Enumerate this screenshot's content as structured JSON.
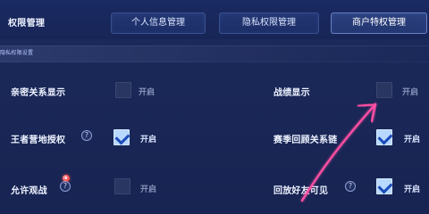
{
  "header": {
    "title": "权限管理",
    "tabs": [
      {
        "label": "个人信息管理"
      },
      {
        "label": "隐私权限管理"
      },
      {
        "label": "商户特权管理"
      }
    ]
  },
  "section": {
    "label": "隐私权限设置"
  },
  "settings": [
    {
      "label": "亲密关系显示",
      "state": "开启",
      "checked": false
    },
    {
      "label": "战绩显示",
      "state": "开启",
      "checked": false
    },
    {
      "label": "王者营地授权",
      "state": "开启",
      "checked": true
    },
    {
      "label": "赛季回顾关系链",
      "state": "开启",
      "checked": true
    },
    {
      "label": "允许观战",
      "state": "开启",
      "checked": false
    },
    {
      "label": "回放好友可见",
      "state": "开启",
      "checked": true
    }
  ],
  "icons": {
    "help": "help-icon",
    "notification": "notification-icon",
    "pointer": "pink-arrow-annotation"
  },
  "colors": {
    "background_top": "#1d2b5c",
    "background_bottom": "#182452",
    "accent_check": "#b8d8ff",
    "accent_check_mark": "#1b4bb8",
    "annotation_pink": "#ff4fa3"
  }
}
